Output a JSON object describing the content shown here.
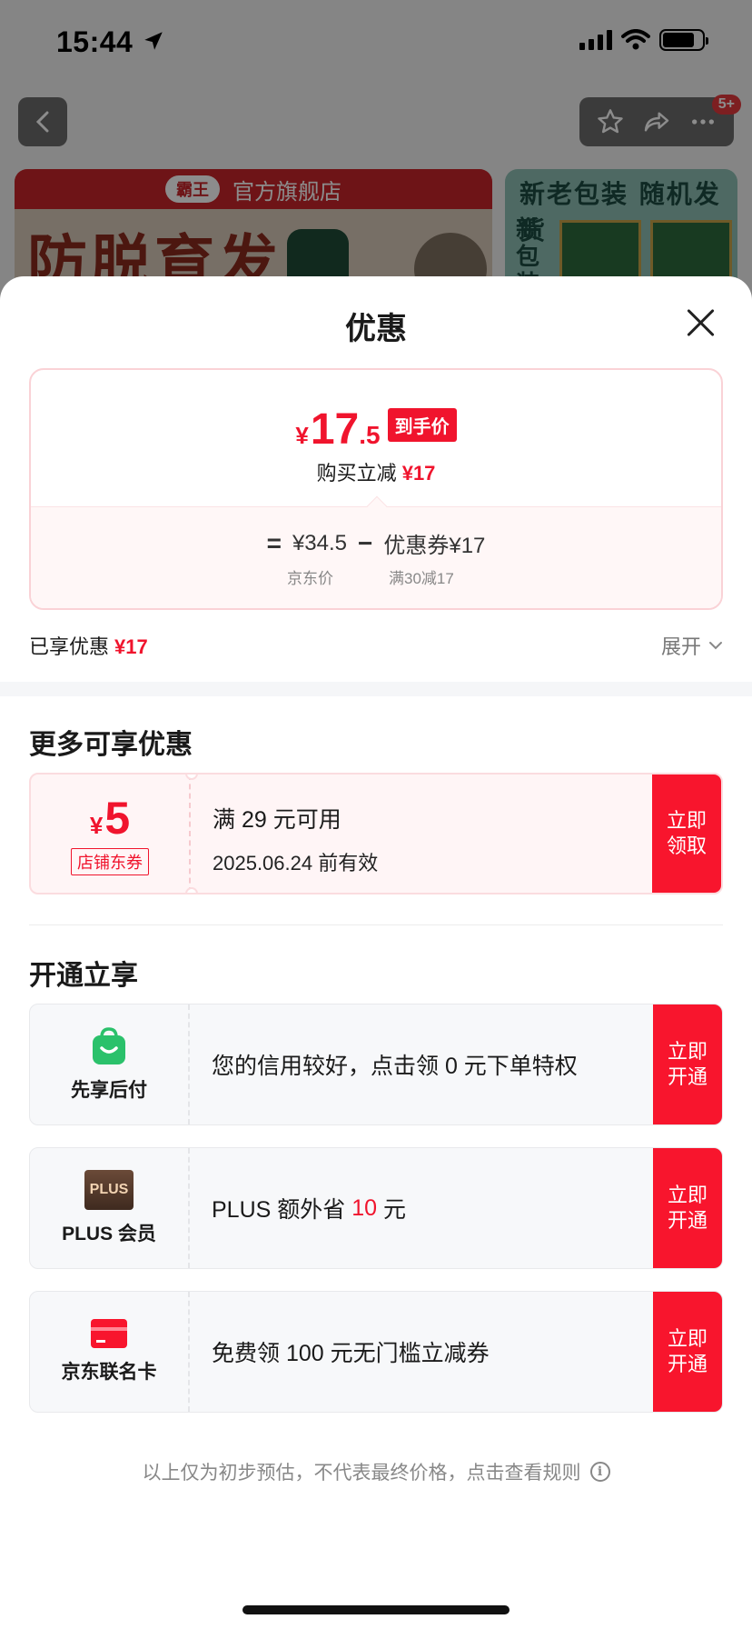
{
  "status_bar": {
    "time": "15:44"
  },
  "nav": {
    "badge": "5+"
  },
  "background": {
    "banner_brand": "霸王",
    "banner_store": "官方旗舰店",
    "banner_slogan": "防脱育发",
    "side_banner_title": "新老包装 随机发货",
    "side_banner_vertical": "新包装"
  },
  "sheet": {
    "title": "优惠",
    "price": {
      "currency": "¥",
      "integer": "17",
      "decimal": ".5",
      "tag": "到手价",
      "reduce_label": "购买立减",
      "reduce_amount": "¥17"
    },
    "calc": {
      "eq": "=",
      "jd_price": "¥34.5",
      "minus": "−",
      "coupon": "优惠券¥17",
      "jd_price_label": "京东价",
      "coupon_rule": "满30减17"
    },
    "enjoyed_label": "已享优惠",
    "enjoyed_amount": "¥17",
    "expand_label": "展开",
    "more_section_title": "更多可享优惠",
    "coupon": {
      "currency": "¥",
      "amount": "5",
      "kind": "店铺东券",
      "condition": "满 29 元可用",
      "validity": "2025.06.24 前有效",
      "action": "立即领取"
    },
    "open_section_title": "开通立享",
    "perks": [
      {
        "name": "先享后付",
        "icon": "shopping-bag-icon",
        "desc": "您的信用较好，点击领 0 元下单特权",
        "action": "立即开通"
      },
      {
        "name": "PLUS 会员",
        "icon": "plus-logo-icon",
        "logo_text": "PLUS",
        "desc_prefix": "PLUS 额外省 ",
        "desc_highlight": "10",
        "desc_suffix": " 元",
        "action": "立即开通"
      },
      {
        "name": "京东联名卡",
        "icon": "credit-card-icon",
        "desc": "免费领 100 元无门槛立减券",
        "action": "立即开通"
      }
    ],
    "footer_note": "以上仅为初步预估，不代表最终价格，点击查看规则"
  },
  "colors": {
    "accent_red": "#f0142d",
    "button_red": "#f8152d",
    "green": "#2bc16b"
  }
}
